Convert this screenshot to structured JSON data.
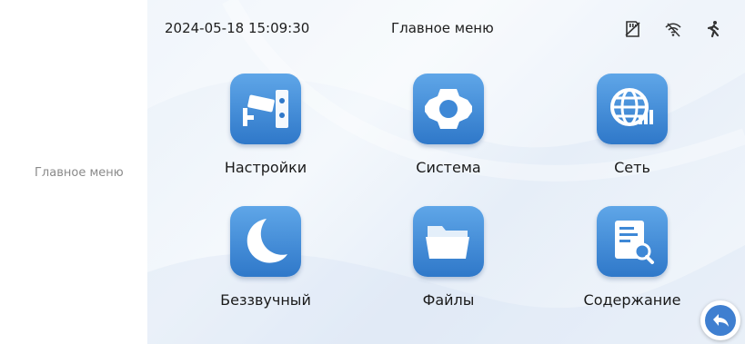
{
  "side_caption": "Главное меню",
  "status_bar": {
    "datetime": "2024-05-18 15:09:30",
    "title": "Главное меню",
    "icons": [
      "sd-card-icon",
      "wifi-icon",
      "motion-icon"
    ]
  },
  "menu": {
    "items": [
      {
        "label": "Настройки",
        "icon": "camera-settings-icon"
      },
      {
        "label": "Система",
        "icon": "gear-icon"
      },
      {
        "label": "Сеть",
        "icon": "globe-network-icon"
      },
      {
        "label": "Беззвучный",
        "icon": "moon-icon"
      },
      {
        "label": "Файлы",
        "icon": "folder-icon"
      },
      {
        "label": "Содержание",
        "icon": "document-search-icon"
      }
    ]
  },
  "colors": {
    "icon_gradient_top": "#5fa6e8",
    "icon_gradient_bottom": "#2f78c9",
    "back_button": "#3f7fd0"
  }
}
